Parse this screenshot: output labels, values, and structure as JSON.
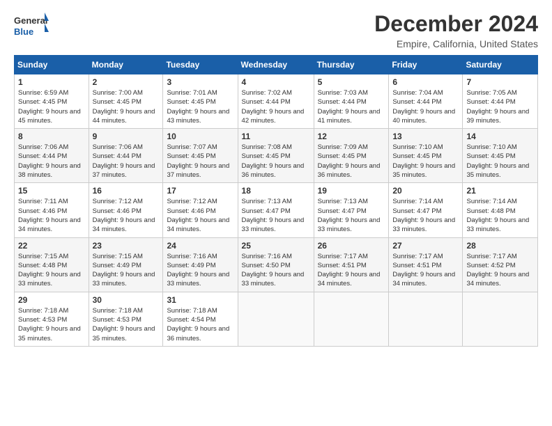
{
  "header": {
    "logo_general": "General",
    "logo_blue": "Blue",
    "title": "December 2024",
    "subtitle": "Empire, California, United States"
  },
  "weekdays": [
    "Sunday",
    "Monday",
    "Tuesday",
    "Wednesday",
    "Thursday",
    "Friday",
    "Saturday"
  ],
  "weeks": [
    [
      {
        "day": "1",
        "sunrise": "6:59 AM",
        "sunset": "4:45 PM",
        "daylight": "9 hours and 45 minutes."
      },
      {
        "day": "2",
        "sunrise": "7:00 AM",
        "sunset": "4:45 PM",
        "daylight": "9 hours and 44 minutes."
      },
      {
        "day": "3",
        "sunrise": "7:01 AM",
        "sunset": "4:45 PM",
        "daylight": "9 hours and 43 minutes."
      },
      {
        "day": "4",
        "sunrise": "7:02 AM",
        "sunset": "4:44 PM",
        "daylight": "9 hours and 42 minutes."
      },
      {
        "day": "5",
        "sunrise": "7:03 AM",
        "sunset": "4:44 PM",
        "daylight": "9 hours and 41 minutes."
      },
      {
        "day": "6",
        "sunrise": "7:04 AM",
        "sunset": "4:44 PM",
        "daylight": "9 hours and 40 minutes."
      },
      {
        "day": "7",
        "sunrise": "7:05 AM",
        "sunset": "4:44 PM",
        "daylight": "9 hours and 39 minutes."
      }
    ],
    [
      {
        "day": "8",
        "sunrise": "7:06 AM",
        "sunset": "4:44 PM",
        "daylight": "9 hours and 38 minutes."
      },
      {
        "day": "9",
        "sunrise": "7:06 AM",
        "sunset": "4:44 PM",
        "daylight": "9 hours and 37 minutes."
      },
      {
        "day": "10",
        "sunrise": "7:07 AM",
        "sunset": "4:45 PM",
        "daylight": "9 hours and 37 minutes."
      },
      {
        "day": "11",
        "sunrise": "7:08 AM",
        "sunset": "4:45 PM",
        "daylight": "9 hours and 36 minutes."
      },
      {
        "day": "12",
        "sunrise": "7:09 AM",
        "sunset": "4:45 PM",
        "daylight": "9 hours and 36 minutes."
      },
      {
        "day": "13",
        "sunrise": "7:10 AM",
        "sunset": "4:45 PM",
        "daylight": "9 hours and 35 minutes."
      },
      {
        "day": "14",
        "sunrise": "7:10 AM",
        "sunset": "4:45 PM",
        "daylight": "9 hours and 35 minutes."
      }
    ],
    [
      {
        "day": "15",
        "sunrise": "7:11 AM",
        "sunset": "4:46 PM",
        "daylight": "9 hours and 34 minutes."
      },
      {
        "day": "16",
        "sunrise": "7:12 AM",
        "sunset": "4:46 PM",
        "daylight": "9 hours and 34 minutes."
      },
      {
        "day": "17",
        "sunrise": "7:12 AM",
        "sunset": "4:46 PM",
        "daylight": "9 hours and 34 minutes."
      },
      {
        "day": "18",
        "sunrise": "7:13 AM",
        "sunset": "4:47 PM",
        "daylight": "9 hours and 33 minutes."
      },
      {
        "day": "19",
        "sunrise": "7:13 AM",
        "sunset": "4:47 PM",
        "daylight": "9 hours and 33 minutes."
      },
      {
        "day": "20",
        "sunrise": "7:14 AM",
        "sunset": "4:47 PM",
        "daylight": "9 hours and 33 minutes."
      },
      {
        "day": "21",
        "sunrise": "7:14 AM",
        "sunset": "4:48 PM",
        "daylight": "9 hours and 33 minutes."
      }
    ],
    [
      {
        "day": "22",
        "sunrise": "7:15 AM",
        "sunset": "4:48 PM",
        "daylight": "9 hours and 33 minutes."
      },
      {
        "day": "23",
        "sunrise": "7:15 AM",
        "sunset": "4:49 PM",
        "daylight": "9 hours and 33 minutes."
      },
      {
        "day": "24",
        "sunrise": "7:16 AM",
        "sunset": "4:49 PM",
        "daylight": "9 hours and 33 minutes."
      },
      {
        "day": "25",
        "sunrise": "7:16 AM",
        "sunset": "4:50 PM",
        "daylight": "9 hours and 33 minutes."
      },
      {
        "day": "26",
        "sunrise": "7:17 AM",
        "sunset": "4:51 PM",
        "daylight": "9 hours and 34 minutes."
      },
      {
        "day": "27",
        "sunrise": "7:17 AM",
        "sunset": "4:51 PM",
        "daylight": "9 hours and 34 minutes."
      },
      {
        "day": "28",
        "sunrise": "7:17 AM",
        "sunset": "4:52 PM",
        "daylight": "9 hours and 34 minutes."
      }
    ],
    [
      {
        "day": "29",
        "sunrise": "7:18 AM",
        "sunset": "4:53 PM",
        "daylight": "9 hours and 35 minutes."
      },
      {
        "day": "30",
        "sunrise": "7:18 AM",
        "sunset": "4:53 PM",
        "daylight": "9 hours and 35 minutes."
      },
      {
        "day": "31",
        "sunrise": "7:18 AM",
        "sunset": "4:54 PM",
        "daylight": "9 hours and 36 minutes."
      },
      null,
      null,
      null,
      null
    ]
  ]
}
